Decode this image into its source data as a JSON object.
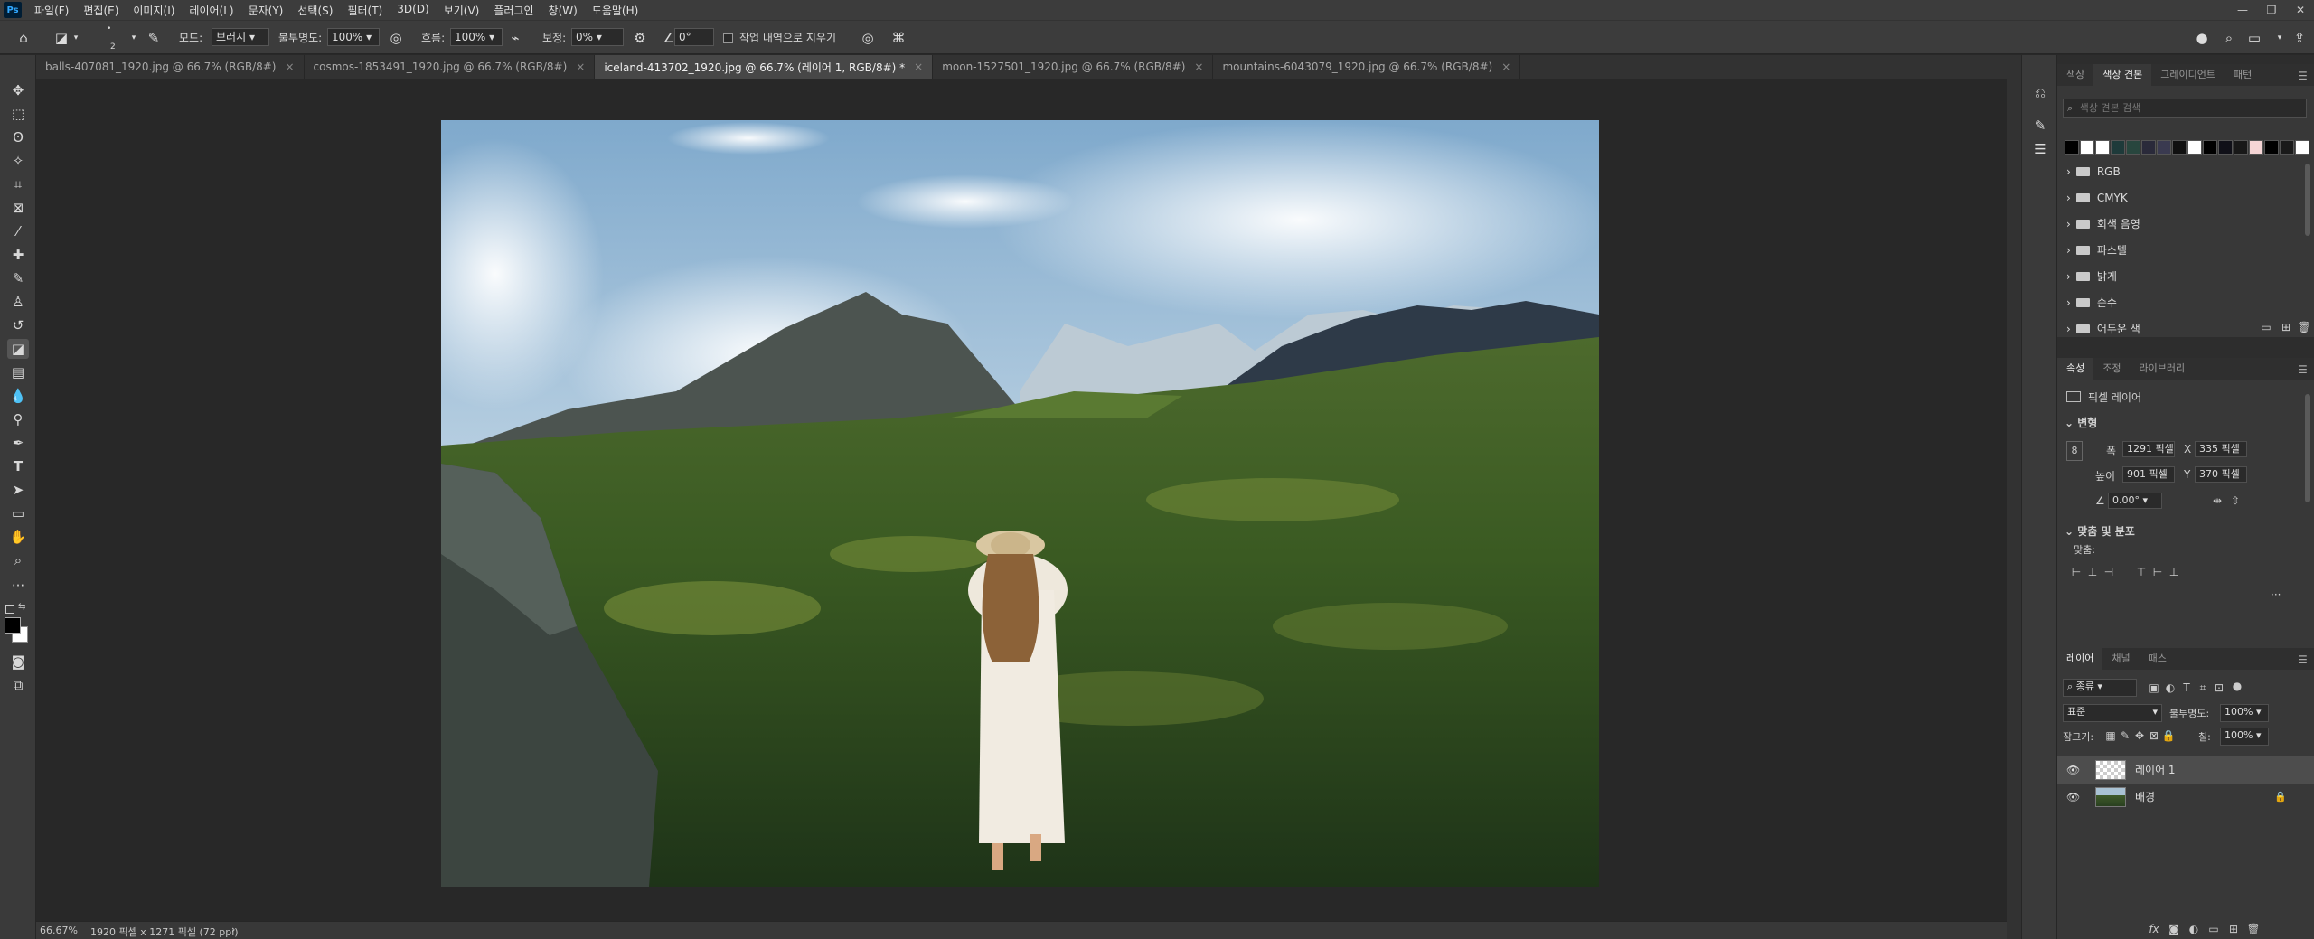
{
  "app": {
    "logo": "Ps",
    "window_controls": [
      "—",
      "❐",
      "✕"
    ]
  },
  "menu": [
    "파일(F)",
    "편집(E)",
    "이미지(I)",
    "레이어(L)",
    "문자(Y)",
    "선택(S)",
    "필터(T)",
    "3D(D)",
    "보기(V)",
    "플러그인",
    "창(W)",
    "도움말(H)"
  ],
  "options": {
    "brush_size": "2",
    "mode_label": "모드:",
    "mode_value": "브러시",
    "opacity_label": "불투명도:",
    "opacity_value": "100%",
    "flow_label": "흐름:",
    "flow_value": "100%",
    "smoothing_label": "보정:",
    "smoothing_value": "0%",
    "angle_value": "0°",
    "erase_history_label": "작업 내역으로 지우기"
  },
  "tabs": [
    {
      "label": "balls-407081_1920.jpg @ 66.7% (RGB/8#)",
      "close": "×"
    },
    {
      "label": "cosmos-1853491_1920.jpg @ 66.7% (RGB/8#)",
      "close": "×"
    },
    {
      "label": "iceland-413702_1920.jpg @ 66.7% (레이어 1, RGB/8#) *",
      "close": "×",
      "active": true
    },
    {
      "label": "moon-1527501_1920.jpg @ 66.7% (RGB/8#)",
      "close": "×"
    },
    {
      "label": "mountains-6043079_1920.jpg @ 66.7% (RGB/8#)",
      "close": "×"
    }
  ],
  "status": {
    "zoom": "66.67%",
    "doc_info": "1920 픽셀 x 1271 픽셀 (72 ppi)",
    "arrow": "›"
  },
  "swatches_panel": {
    "tabs": [
      "색상",
      "색상 견본",
      "그레이디언트",
      "패턴"
    ],
    "active_tab": 1,
    "search_placeholder": "색상 견본 검색",
    "swatch_colors": [
      "#000000",
      "#ffffff",
      "#ffffff",
      "#1e3a3a",
      "#28463e",
      "#2a2a3a",
      "#3a3a50",
      "#101010",
      "#ffffff",
      "#000000",
      "#101018",
      "#181818",
      "#f5d5d5",
      "#000000",
      "#1a1a1a",
      "#ffffff"
    ],
    "groups": [
      "RGB",
      "CMYK",
      "회색 음영",
      "파스텔",
      "밝게",
      "순수",
      "어두운 색"
    ]
  },
  "properties_panel": {
    "tabs": [
      "속성",
      "조정",
      "라이브러리"
    ],
    "active_tab": 0,
    "layer_type": "픽셀 레이어",
    "transform_title": "변형",
    "w_label": "폭",
    "w_value": "1291 픽셀",
    "x_label": "X",
    "x_value": "335 픽셀",
    "h_label": "높이",
    "h_value": "901 픽셀",
    "y_label": "Y",
    "y_value": "370 픽셀",
    "angle_value": "0.00°",
    "align_title": "맞춤 및 분포",
    "align_label": "맞춤:",
    "more": "···"
  },
  "layers_panel": {
    "tabs": [
      "레이어",
      "채널",
      "패스"
    ],
    "active_tab": 0,
    "filter_kind": "종류",
    "blend_mode": "표준",
    "opacity_label": "불투명도:",
    "opacity_value": "100%",
    "lock_label": "잠그기:",
    "fill_label": "칠:",
    "fill_value": "100%",
    "layers": [
      {
        "name": "레이어 1",
        "selected": true
      },
      {
        "name": "배경",
        "locked": true
      }
    ],
    "fx": "fx"
  }
}
